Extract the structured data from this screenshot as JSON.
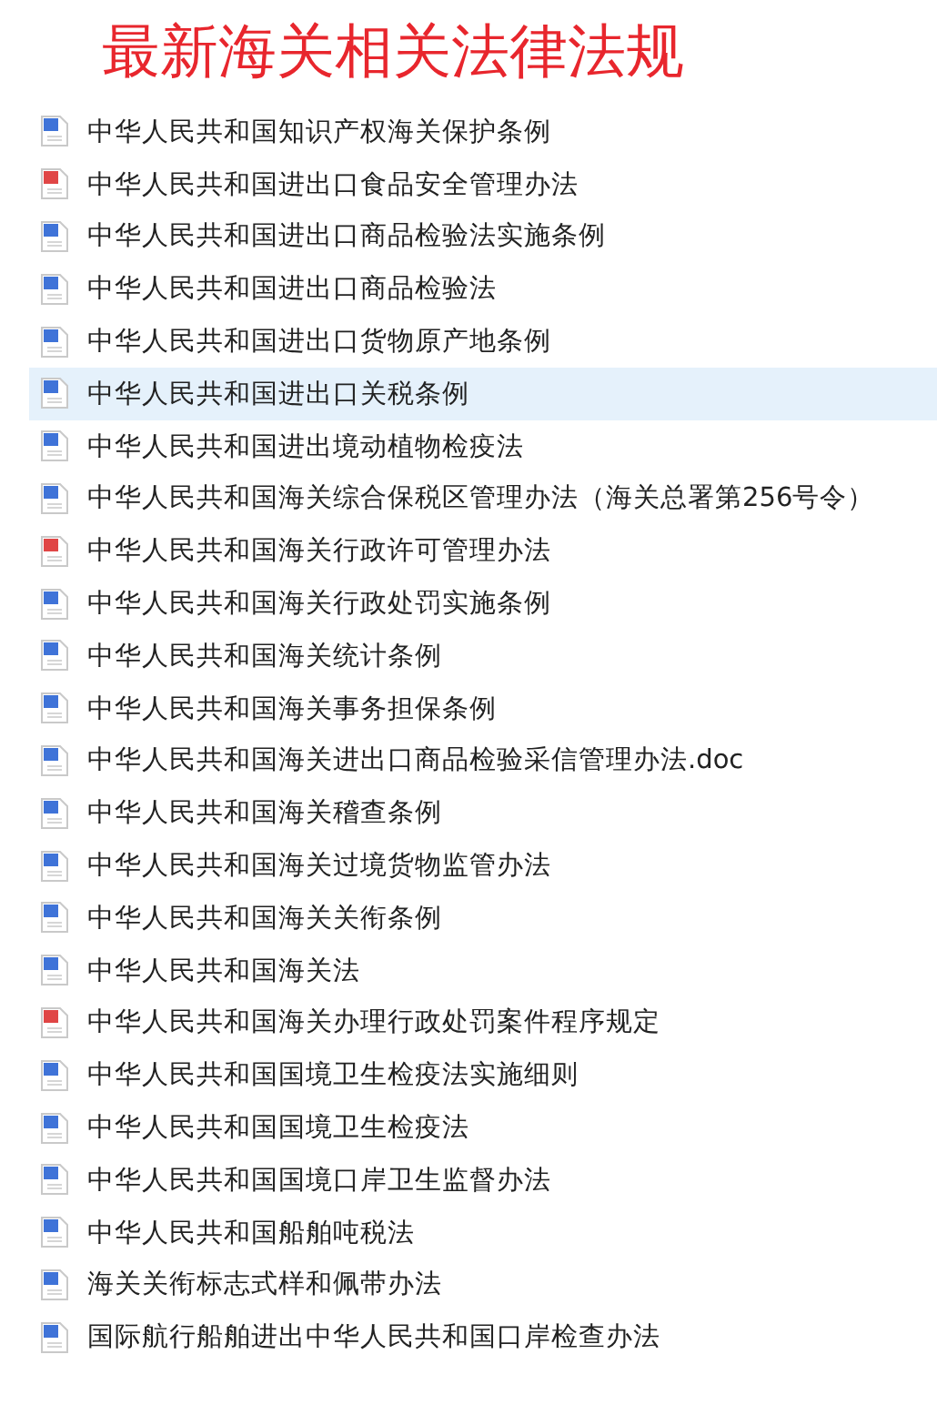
{
  "title": "最新海关相关法律法规",
  "files": [
    {
      "name": "中华人民共和国知识产权海关保护条例",
      "kind": "word",
      "selected": false
    },
    {
      "name": "中华人民共和国进出口食品安全管理办法",
      "kind": "pdf",
      "selected": false
    },
    {
      "name": "中华人民共和国进出口商品检验法实施条例",
      "kind": "word",
      "selected": false
    },
    {
      "name": "中华人民共和国进出口商品检验法",
      "kind": "word",
      "selected": false
    },
    {
      "name": "中华人民共和国进出口货物原产地条例",
      "kind": "word",
      "selected": false
    },
    {
      "name": "中华人民共和国进出口关税条例",
      "kind": "word",
      "selected": true
    },
    {
      "name": "中华人民共和国进出境动植物检疫法",
      "kind": "word",
      "selected": false
    },
    {
      "name": "中华人民共和国海关综合保税区管理办法（海关总署第256号令）",
      "kind": "word",
      "selected": false
    },
    {
      "name": "中华人民共和国海关行政许可管理办法",
      "kind": "pdf",
      "selected": false
    },
    {
      "name": "中华人民共和国海关行政处罚实施条例",
      "kind": "word",
      "selected": false
    },
    {
      "name": "中华人民共和国海关统计条例",
      "kind": "word",
      "selected": false
    },
    {
      "name": "中华人民共和国海关事务担保条例",
      "kind": "word",
      "selected": false
    },
    {
      "name": "中华人民共和国海关进出口商品检验采信管理办法.doc",
      "kind": "word",
      "selected": false
    },
    {
      "name": "中华人民共和国海关稽查条例",
      "kind": "word",
      "selected": false
    },
    {
      "name": "中华人民共和国海关过境货物监管办法",
      "kind": "word",
      "selected": false
    },
    {
      "name": "中华人民共和国海关关衔条例",
      "kind": "word",
      "selected": false
    },
    {
      "name": "中华人民共和国海关法",
      "kind": "word",
      "selected": false
    },
    {
      "name": "中华人民共和国海关办理行政处罚案件程序规定",
      "kind": "pdf",
      "selected": false
    },
    {
      "name": "中华人民共和国国境卫生检疫法实施细则",
      "kind": "word",
      "selected": false
    },
    {
      "name": "中华人民共和国国境卫生检疫法",
      "kind": "word",
      "selected": false
    },
    {
      "name": "中华人民共和国国境口岸卫生监督办法",
      "kind": "word",
      "selected": false
    },
    {
      "name": "中华人民共和国船舶吨税法",
      "kind": "word",
      "selected": false
    },
    {
      "name": "海关关衔标志式样和佩带办法",
      "kind": "word",
      "selected": false
    },
    {
      "name": "国际航行船舶进出中华人民共和国口岸检查办法",
      "kind": "word",
      "selected": false
    }
  ]
}
